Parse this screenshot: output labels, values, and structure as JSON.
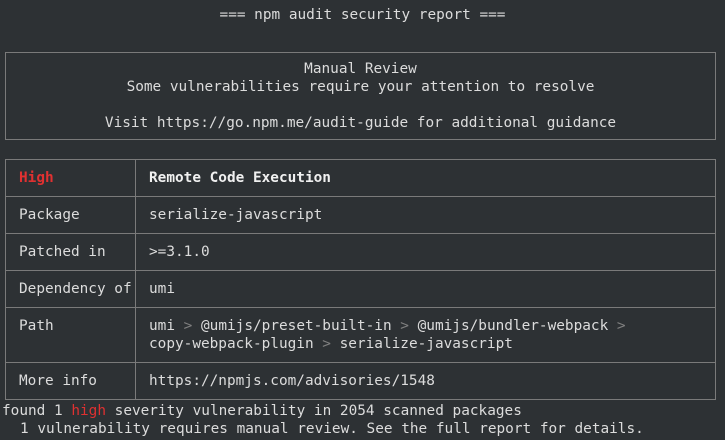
{
  "header": {
    "title": "=== npm audit security report ==="
  },
  "review_box": {
    "title": "Manual Review",
    "subtitle": "Some vulnerabilities require your attention to resolve",
    "guide": "Visit https://go.npm.me/audit-guide for additional guidance"
  },
  "advisory": {
    "severity": "High",
    "title": "Remote Code Execution",
    "package_label": "Package",
    "package": "serialize-javascript",
    "patched_label": "Patched in",
    "patched": ">=3.1.0",
    "dependency_label": "Dependency of",
    "dependency": "umi",
    "path_label": "Path",
    "path": {
      "segments": [
        "umi",
        "@umijs/preset-built-in",
        "@umijs/bundler-webpack",
        "copy-webpack-plugin",
        "serialize-javascript"
      ],
      "separator": ">"
    },
    "more_info_label": "More info",
    "more_info": "https://npmjs.com/advisories/1548"
  },
  "summary": {
    "prefix": "found 1",
    "severity_word": "high",
    "suffix": "severity vulnerability in 2054 scanned packages",
    "line2": "1 vulnerability requires manual review. See the full report for details."
  },
  "colors": {
    "background": "#2d3134",
    "text": "#dcdcdc",
    "high": "#e03131",
    "border": "#7a7a7a"
  }
}
